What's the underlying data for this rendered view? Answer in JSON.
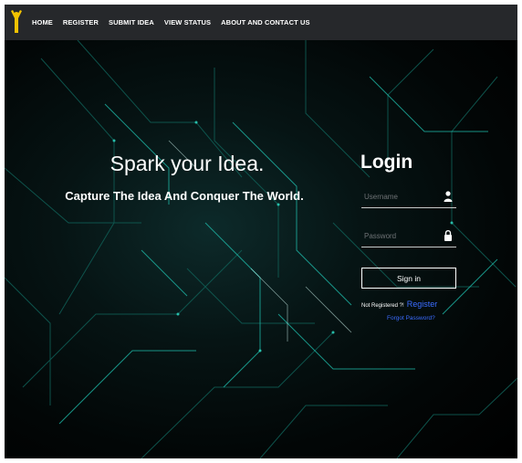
{
  "navbar": {
    "items": [
      {
        "label": "HOME"
      },
      {
        "label": "REGISTER"
      },
      {
        "label": "SUBMIT IDEA"
      },
      {
        "label": "VIEW STATUS"
      },
      {
        "label": "ABOUT AND CONTACT US"
      }
    ],
    "logo_icon": "person-arms-up-icon",
    "background": "#26282b",
    "logo_color": "#f2c200"
  },
  "hero": {
    "title": "Spark your Idea.",
    "subtitle": "Capture The Idea And Conquer The World.",
    "background_icon": "circuit-board-pattern"
  },
  "login": {
    "title": "Login",
    "username_placeholder": "Username",
    "username_icon": "user-icon",
    "password_placeholder": "Password",
    "password_icon": "lock-icon",
    "signin_label": "Sign in",
    "not_registered_text": "Not Registered ?!",
    "register_link": "Register",
    "forgot_link": "Forgot Password?",
    "link_color": "#3b6cff"
  }
}
